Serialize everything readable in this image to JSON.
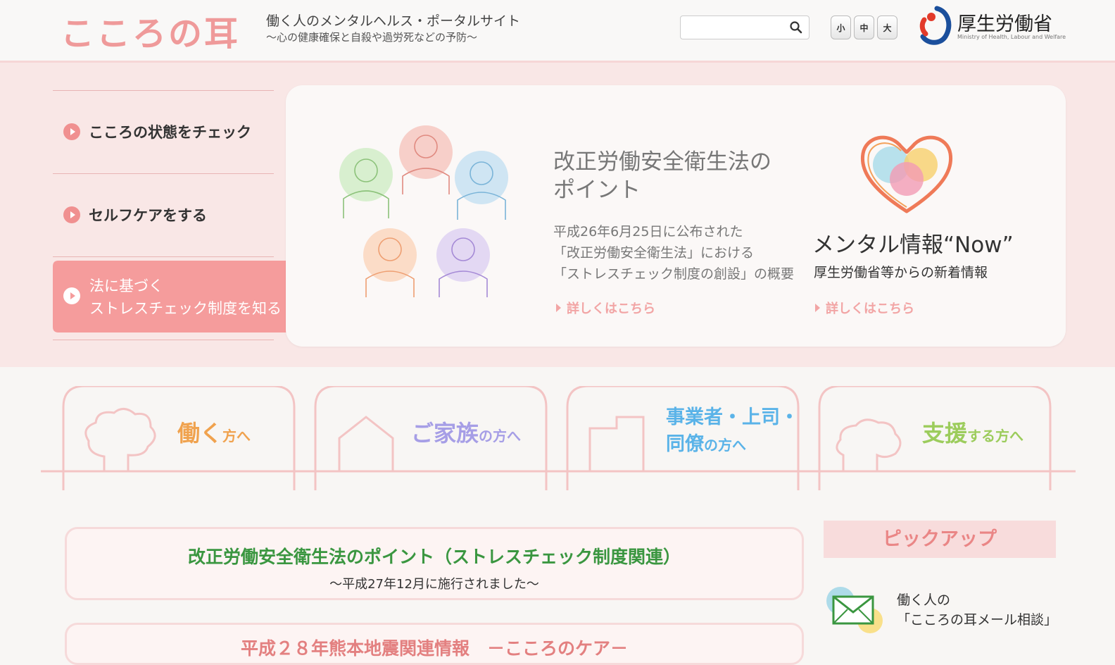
{
  "header": {
    "logo": "こころの耳",
    "tagline": "働く人のメンタルヘルス・ポータルサイト",
    "subtitle": "～心の健康確保と自殺や過労死などの予防～",
    "search_placeholder": "",
    "font_small": "小",
    "font_medium": "中",
    "font_large": "大",
    "ministry_name": "厚生労働省",
    "ministry_en": "Ministry of Health, Labour and Welfare"
  },
  "nav": {
    "items": [
      {
        "label": "こころの状態をチェック"
      },
      {
        "label": "セルフケアをする"
      },
      {
        "label_line1": "法に基づく",
        "label_line2": "ストレスチェック制度を知る"
      }
    ]
  },
  "hero": {
    "title_line1": "改正労働安全衛生法の",
    "title_line2": "ポイント",
    "desc_line1": "平成26年6月25日に公布された",
    "desc_line2": "「改正労働安全衛生法」における",
    "desc_line3": "「ストレスチェック制度の創設」の概要",
    "more": "詳しくはこちら",
    "now_title": "メンタル情報“Now”",
    "now_sub": "厚生労働省等からの新着情報",
    "now_more": "詳しくはこちら"
  },
  "audience": [
    {
      "main": "働く",
      "suffix": "方へ",
      "color": "#f0a24e"
    },
    {
      "main": "ご家族",
      "suffix": "の方へ",
      "color": "#a69ee6"
    },
    {
      "main_line1": "事業者・上司・",
      "main_line2": "同僚",
      "suffix": "の方へ",
      "color": "#5ab3e8"
    },
    {
      "main": "支援",
      "suffix": "する方へ",
      "color": "#9ccc5c"
    }
  ],
  "notices": [
    {
      "title": "改正労働安全衛生法のポイント（ストレスチェック制度関連）",
      "sub": "～平成27年12月に施行されました～"
    },
    {
      "title": "平成２８年熊本地震関連情報　－こころのケア－"
    }
  ],
  "pickup": {
    "title": "ピックアップ",
    "mail_line1": "働く人の",
    "mail_line2": "「こころの耳メール相談」"
  },
  "colors": {
    "accent": "#f59c9c",
    "band": "#f9e7e6",
    "green": "#3a9640"
  }
}
